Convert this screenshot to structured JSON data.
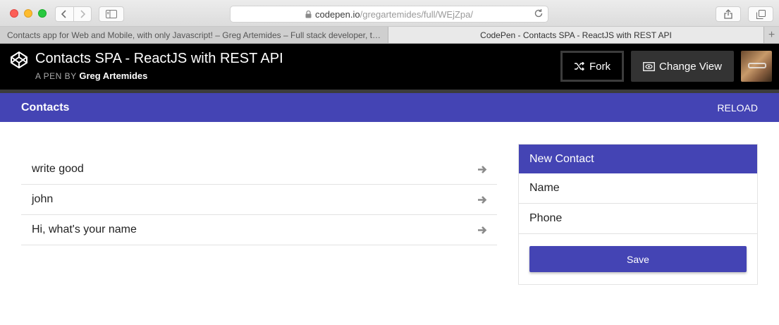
{
  "browser": {
    "url_host": "codepen.io",
    "url_path": "/gregartemides/full/WEjZpa/",
    "tabs": [
      {
        "label": "Contacts app for Web and Mobile, with only Javascript! – Greg Artemides – Full stack developer, t…"
      },
      {
        "label": "CodePen - Contacts SPA - ReactJS with REST API"
      }
    ]
  },
  "codepen": {
    "title": "Contacts SPA - ReactJS with REST API",
    "byline_prefix": "A PEN BY",
    "author": "Greg Artemides",
    "fork_label": "Fork",
    "change_view_label": "Change View"
  },
  "app": {
    "title": "Contacts",
    "reload_label": "RELOAD",
    "contacts": [
      "write good",
      "john",
      "Hi, what's your name"
    ]
  },
  "new_contact": {
    "title": "New Contact",
    "name_placeholder": "Name",
    "phone_placeholder": "Phone",
    "save_label": "Save"
  },
  "colors": {
    "accent": "#4444b4",
    "header_bg": "#000000"
  }
}
